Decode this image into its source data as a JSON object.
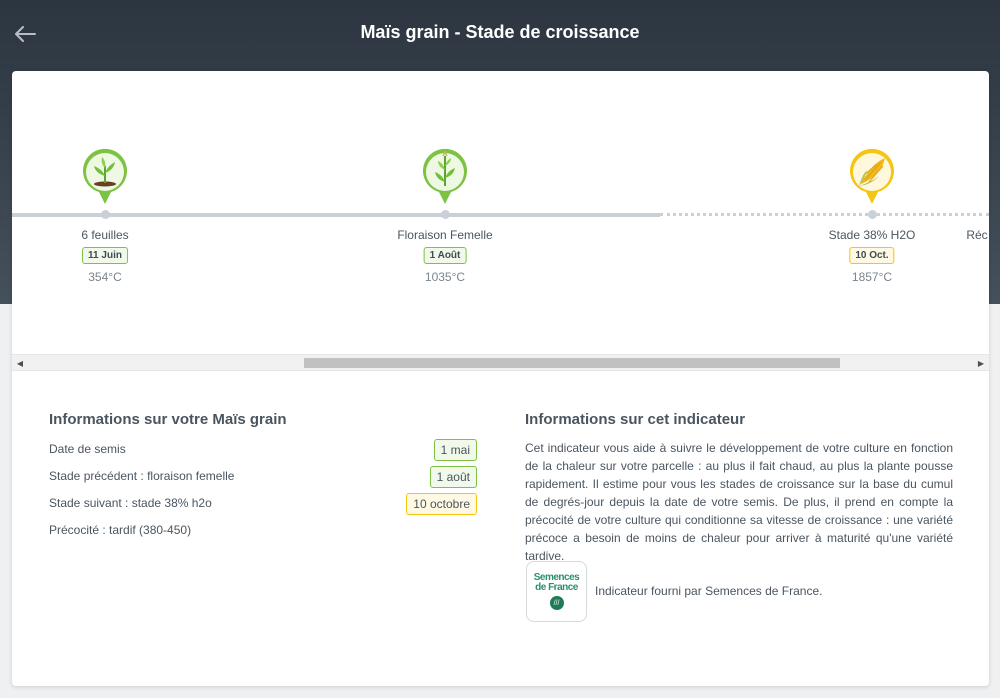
{
  "header": {
    "title": "Maïs grain - Stade de croissance",
    "back_icon": "arrow-left-icon"
  },
  "timeline": {
    "stages": [
      {
        "label": "6 feuilles",
        "date": "11 Juin",
        "gdd": "354°C",
        "status": "done",
        "icon": "young-plant-icon",
        "color": "#7cc243"
      },
      {
        "label": "Floraison Femelle",
        "date": "1 Août",
        "gdd": "1035°C",
        "status": "done",
        "icon": "flowering-plant-icon",
        "color": "#7cc243"
      },
      {
        "label": "Stade 38% H2O",
        "date": "10 Oct.",
        "gdd": "1857°C",
        "status": "next",
        "icon": "corn-cob-icon",
        "color": "#f3c614"
      },
      {
        "label": "Réc",
        "status": "future"
      }
    ]
  },
  "scrollbar": {
    "left_icon": "scroll-left-arrow-icon",
    "right_icon": "scroll-right-arrow-icon"
  },
  "crop_info": {
    "title": "Informations sur votre Maïs grain",
    "rows": [
      {
        "label": "Date de semis",
        "value": "1 mai",
        "color": "green"
      },
      {
        "label": "Stade précédent : floraison femelle",
        "value": "1 août",
        "color": "green"
      },
      {
        "label": "Stade suivant : stade 38% h2o",
        "value": "10 octobre",
        "color": "yellow"
      },
      {
        "label": "Précocité : tardif (380-450)"
      }
    ]
  },
  "indicator_info": {
    "title": "Informations sur cet indicateur",
    "description": "Cet indicateur vous aide à suivre le développement de votre culture en fonction de la chaleur sur votre parcelle : au plus il fait chaud, au plus la plante pousse rapidement. Il estime pour vous les stades de croissance sur la base du cumul de degrés-jour depuis la date de votre semis. De plus, il prend en compte la précocité de votre culture qui conditionne sa vitesse de croissance : une variété précoce a besoin de moins de chaleur pour arriver à maturité qu'une variété tardive.",
    "logo_line1": "Semences",
    "logo_line2": "de France",
    "provider": "Indicateur fourni par Semences de France."
  },
  "colors": {
    "accent_green": "#7cc243",
    "accent_yellow": "#f3c614",
    "header_bg": "#2c3540"
  }
}
